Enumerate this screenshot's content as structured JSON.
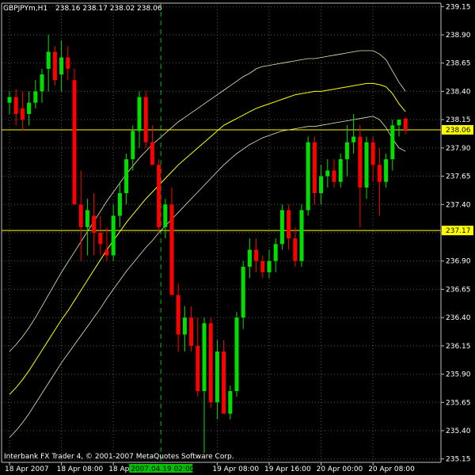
{
  "header": {
    "symbol": "GBPJPYm,H1",
    "ohlc": "238.16 238.17 238.02 238.06"
  },
  "footer": {
    "platform_text": "Interbank FX Trader 4, © 2001-2007 MetaQuotes Software Corp."
  },
  "colors": {
    "background": "#000000",
    "grid": "#4a5a4a",
    "axis": "#c0c0c0",
    "bull": "#00e000",
    "bear": "#ff0000",
    "band_outer": "#e8e8b0",
    "band_mid": "#ffff00",
    "hline": "#ffff00",
    "vline": "#00c000",
    "price_tag": "#ffff00",
    "time_tag": "#00c000"
  },
  "chart_data": {
    "type": "candlestick",
    "ylim": [
      235.12,
      239.18
    ],
    "y_ticks": [
      "239.15",
      "238.90",
      "238.65",
      "238.40",
      "238.15",
      "237.90",
      "237.65",
      "237.40",
      "237.15",
      "236.90",
      "236.65",
      "236.40",
      "236.15",
      "235.90",
      "235.65",
      "235.40",
      "235.15"
    ],
    "x_labels": [
      {
        "text": "18 Apr 2007",
        "bar": 0
      },
      {
        "text": "18 Apr 08:00",
        "bar": 8
      },
      {
        "text": "18 Apr 16:00",
        "bar": 16
      },
      {
        "text": "19 Apr 08:00",
        "bar": 32
      },
      {
        "text": "19 Apr 16:00",
        "bar": 40
      },
      {
        "text": "20 Apr 00:00",
        "bar": 48
      },
      {
        "text": "20 Apr 08:00",
        "bar": 56
      }
    ],
    "time_marker": {
      "text": "2007.04.19 02:00",
      "bar": 26
    },
    "hlines": [
      {
        "value": 238.06,
        "label": "238.06"
      },
      {
        "value": 237.17,
        "label": "237.17"
      }
    ],
    "candles": [
      [
        238.3,
        238.4,
        238.2,
        238.35
      ],
      [
        238.35,
        238.42,
        238.1,
        238.2
      ],
      [
        238.25,
        238.4,
        238.05,
        238.15
      ],
      [
        238.2,
        238.4,
        238.1,
        238.3
      ],
      [
        238.3,
        238.5,
        238.25,
        238.4
      ],
      [
        238.4,
        238.6,
        238.3,
        238.55
      ],
      [
        238.6,
        238.9,
        238.4,
        238.75
      ],
      [
        238.75,
        238.8,
        238.45,
        238.5
      ],
      [
        238.55,
        238.85,
        238.4,
        238.7
      ],
      [
        238.7,
        238.8,
        238.5,
        238.6
      ],
      [
        238.5,
        238.6,
        237.4,
        237.4
      ],
      [
        237.4,
        237.7,
        236.9,
        237.2
      ],
      [
        237.2,
        237.45,
        236.95,
        237.35
      ],
      [
        237.3,
        237.5,
        236.95,
        237.15
      ],
      [
        237.15,
        237.3,
        236.95,
        237.05
      ],
      [
        237.0,
        237.2,
        236.9,
        236.95
      ],
      [
        236.95,
        237.4,
        236.9,
        237.3
      ],
      [
        237.3,
        237.6,
        237.2,
        237.5
      ],
      [
        237.5,
        237.85,
        237.4,
        237.8
      ],
      [
        237.8,
        238.1,
        237.7,
        238.05
      ],
      [
        238.05,
        238.4,
        237.9,
        238.35
      ],
      [
        238.35,
        238.4,
        237.9,
        237.95
      ],
      [
        237.95,
        238.1,
        237.8,
        237.75
      ],
      [
        237.75,
        237.8,
        237.15,
        237.2
      ],
      [
        237.2,
        237.45,
        237.1,
        237.4
      ],
      [
        237.4,
        237.55,
        236.9,
        236.6
      ],
      [
        236.6,
        236.7,
        236.1,
        236.25
      ],
      [
        236.25,
        236.5,
        236.1,
        236.4
      ],
      [
        236.4,
        236.5,
        236.1,
        236.15
      ],
      [
        236.15,
        236.4,
        235.7,
        235.75
      ],
      [
        235.75,
        236.4,
        235.2,
        236.35
      ],
      [
        236.35,
        236.4,
        235.6,
        235.65
      ],
      [
        235.65,
        236.2,
        235.5,
        236.1
      ],
      [
        236.1,
        236.2,
        235.6,
        235.55
      ],
      [
        235.55,
        235.8,
        235.5,
        235.75
      ],
      [
        235.75,
        236.45,
        235.7,
        236.4
      ],
      [
        236.4,
        236.9,
        236.3,
        236.85
      ],
      [
        236.85,
        237.1,
        236.75,
        237.0
      ],
      [
        237.0,
        237.1,
        236.8,
        236.9
      ],
      [
        236.9,
        236.95,
        236.75,
        236.8
      ],
      [
        236.8,
        237.0,
        236.75,
        236.9
      ],
      [
        236.9,
        237.1,
        236.8,
        237.05
      ],
      [
        237.05,
        237.4,
        237.0,
        237.35
      ],
      [
        237.35,
        237.4,
        237.0,
        237.1
      ],
      [
        237.1,
        237.2,
        236.85,
        236.9
      ],
      [
        236.9,
        237.4,
        236.85,
        237.35
      ],
      [
        237.35,
        238.0,
        237.3,
        237.95
      ],
      [
        237.95,
        238.0,
        237.4,
        237.5
      ],
      [
        237.5,
        237.75,
        237.4,
        237.65
      ],
      [
        237.65,
        237.8,
        237.55,
        237.7
      ],
      [
        237.7,
        237.8,
        237.55,
        237.6
      ],
      [
        237.6,
        237.85,
        237.55,
        237.8
      ],
      [
        237.8,
        238.1,
        237.65,
        237.95
      ],
      [
        237.95,
        238.2,
        237.85,
        238.0
      ],
      [
        238.0,
        238.1,
        237.2,
        237.55
      ],
      [
        237.55,
        238.0,
        237.45,
        237.95
      ],
      [
        237.95,
        238.0,
        237.6,
        237.75
      ],
      [
        237.75,
        237.9,
        237.3,
        237.6
      ],
      [
        237.6,
        237.85,
        237.55,
        237.8
      ],
      [
        237.8,
        238.15,
        237.7,
        238.1
      ],
      [
        238.1,
        238.15,
        238.0,
        238.15
      ],
      [
        238.16,
        238.17,
        238.02,
        238.06
      ]
    ],
    "band_mid": [
      235.72,
      235.78,
      235.85,
      235.93,
      236.02,
      236.11,
      236.2,
      236.29,
      236.38,
      236.46,
      236.55,
      236.64,
      236.73,
      236.82,
      236.91,
      237.0,
      237.08,
      237.16,
      237.24,
      237.31,
      237.38,
      237.45,
      237.51,
      237.57,
      237.63,
      237.69,
      237.75,
      237.8,
      237.85,
      237.9,
      237.95,
      238.0,
      238.05,
      238.1,
      238.13,
      238.16,
      238.19,
      238.22,
      238.25,
      238.27,
      238.29,
      238.31,
      238.33,
      238.35,
      238.37,
      238.38,
      238.39,
      238.4,
      238.4,
      238.41,
      238.42,
      238.43,
      238.44,
      238.45,
      238.46,
      238.47,
      238.47,
      238.46,
      238.44,
      238.38,
      238.29,
      238.22
    ],
    "band_upper": [
      236.1,
      236.16,
      236.23,
      236.31,
      236.4,
      236.5,
      236.6,
      236.7,
      236.8,
      236.89,
      236.98,
      237.07,
      237.16,
      237.25,
      237.34,
      237.43,
      237.51,
      237.59,
      237.67,
      237.74,
      237.81,
      237.87,
      237.93,
      237.98,
      238.03,
      238.08,
      238.13,
      238.17,
      238.21,
      238.25,
      238.29,
      238.33,
      238.37,
      238.41,
      238.45,
      238.49,
      238.53,
      238.56,
      238.6,
      238.62,
      238.63,
      238.64,
      238.65,
      238.66,
      238.67,
      238.68,
      238.69,
      238.69,
      238.7,
      238.71,
      238.72,
      238.73,
      238.74,
      238.75,
      238.76,
      238.76,
      238.76,
      238.73,
      238.68,
      238.58,
      238.48,
      238.4
    ],
    "band_lower": [
      235.34,
      235.4,
      235.47,
      235.55,
      235.64,
      235.73,
      235.82,
      235.91,
      236.0,
      236.08,
      236.16,
      236.24,
      236.32,
      236.4,
      236.48,
      236.57,
      236.65,
      236.73,
      236.81,
      236.88,
      236.95,
      237.02,
      237.08,
      237.15,
      237.21,
      237.27,
      237.33,
      237.39,
      237.45,
      237.51,
      237.57,
      237.63,
      237.69,
      237.75,
      237.8,
      237.85,
      237.89,
      237.93,
      237.96,
      237.99,
      238.01,
      238.03,
      238.05,
      238.06,
      238.07,
      238.08,
      238.09,
      238.09,
      238.1,
      238.11,
      238.12,
      238.13,
      238.14,
      238.15,
      238.16,
      238.17,
      238.18,
      238.15,
      238.08,
      237.98,
      237.9,
      237.87
    ]
  }
}
